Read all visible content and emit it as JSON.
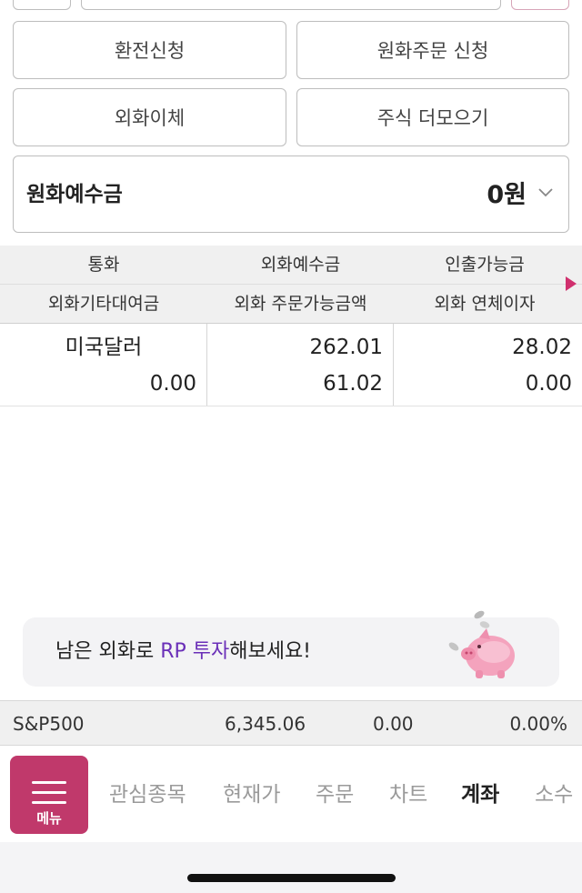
{
  "actions": {
    "exchange_request": "환전신청",
    "krw_order_request": "원화주문 신청",
    "fx_transfer": "외화이체",
    "stocks_more": "주식 더모으기"
  },
  "deposit": {
    "label": "원화예수금",
    "amount": "0원"
  },
  "table": {
    "header_row1": [
      "통화",
      "외화예수금",
      "인출가능금"
    ],
    "header_row2": [
      "외화기타대여금",
      "외화 주문가능금액",
      "외화 연체이자"
    ],
    "rows": [
      {
        "currency": "미국달러",
        "fx_deposit": "262.01",
        "withdrawable": "28.02",
        "other_loan": "0.00",
        "orderable": "61.02",
        "overdue_interest": "0.00"
      }
    ]
  },
  "banner": {
    "text_before": "남은 외화로 ",
    "highlight": "RP 투자",
    "text_after": "해보세요!"
  },
  "ticker": {
    "name": "S&P500",
    "price": "6,345.06",
    "change": "0.00",
    "change_pct": "0.00%"
  },
  "nav": {
    "menu_label": "메뉴",
    "items": [
      "관심종목",
      "현재가",
      "주문",
      "차트",
      "계좌",
      "소수"
    ],
    "active": "계좌"
  },
  "colors": {
    "brand": "#c0396b",
    "highlight": "#6a2fb8",
    "arrow": "#d0306e"
  },
  "icons": [
    "menu-icon",
    "chevron-down-icon",
    "piggy-bank-icon",
    "more-columns-arrow-icon"
  ]
}
